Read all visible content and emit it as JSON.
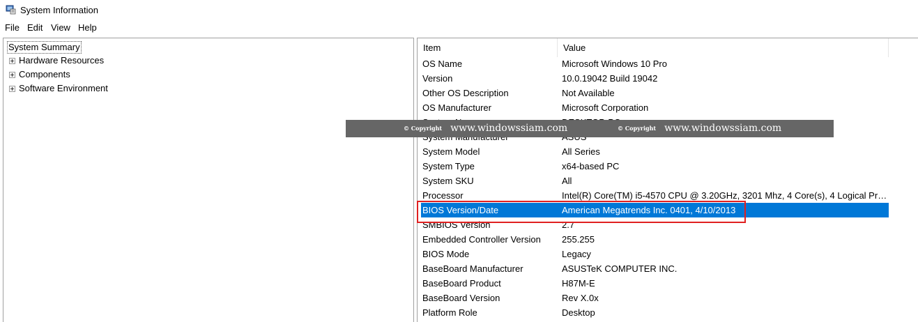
{
  "window": {
    "title": "System Information"
  },
  "menu": [
    "File",
    "Edit",
    "View",
    "Help"
  ],
  "tree": {
    "root": "System Summary",
    "children": [
      "Hardware Resources",
      "Components",
      "Software Environment"
    ]
  },
  "table": {
    "headers": {
      "item": "Item",
      "value": "Value"
    },
    "rows": [
      {
        "item": "OS Name",
        "value": "Microsoft Windows 10 Pro"
      },
      {
        "item": "Version",
        "value": "10.0.19042 Build 19042"
      },
      {
        "item": "Other OS Description",
        "value": "Not Available"
      },
      {
        "item": "OS Manufacturer",
        "value": "Microsoft Corporation"
      },
      {
        "item": "System Name",
        "value": "DESKTOP-PC"
      },
      {
        "item": "System Manufacturer",
        "value": "ASUS"
      },
      {
        "item": "System Model",
        "value": "All Series"
      },
      {
        "item": "System Type",
        "value": "x64-based PC"
      },
      {
        "item": "System SKU",
        "value": "All"
      },
      {
        "item": "Processor",
        "value": "Intel(R) Core(TM) i5-4570 CPU @ 3.20GHz, 3201 Mhz, 4 Core(s), 4 Logical Pro..."
      },
      {
        "item": "BIOS Version/Date",
        "value": "American Megatrends Inc. 0401, 4/10/2013"
      },
      {
        "item": "SMBIOS Version",
        "value": "2.7"
      },
      {
        "item": "Embedded Controller Version",
        "value": "255.255"
      },
      {
        "item": "BIOS Mode",
        "value": "Legacy"
      },
      {
        "item": "BaseBoard Manufacturer",
        "value": "ASUSTeK COMPUTER INC."
      },
      {
        "item": "BaseBoard Product",
        "value": "H87M-E"
      },
      {
        "item": "BaseBoard Version",
        "value": "Rev X.0x"
      },
      {
        "item": "Platform Role",
        "value": "Desktop"
      }
    ],
    "selected_item": "BIOS Version/Date"
  },
  "watermark": {
    "copyright": "© Copyright",
    "url": "www.windowssiam.com"
  },
  "colors": {
    "selection": "#0078d7",
    "highlight": "#e02020",
    "watermark_bg": "#666666"
  }
}
